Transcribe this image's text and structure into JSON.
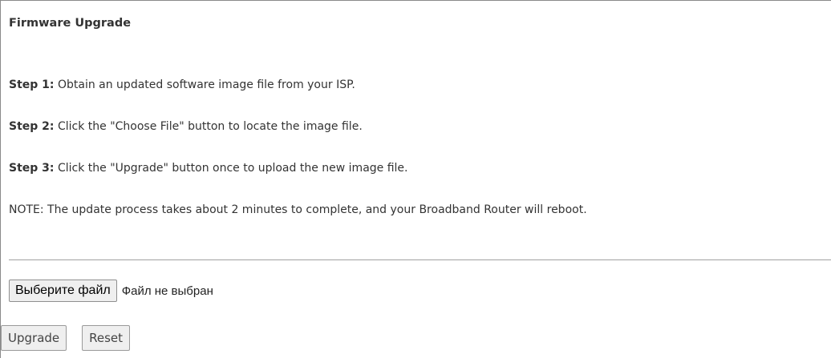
{
  "page": {
    "title": "Firmware Upgrade"
  },
  "steps": [
    {
      "label": "Step 1:",
      "text": " Obtain an updated software image file from your ISP."
    },
    {
      "label": "Step 2:",
      "text": " Click the \"Choose File\" button to locate the image file."
    },
    {
      "label": "Step 3:",
      "text": " Click the \"Upgrade\" button once to upload the new image file."
    }
  ],
  "note": "NOTE: The update process takes about 2 minutes to complete, and your Broadband Router will reboot.",
  "file_input": {
    "button_label": "Выберите файл",
    "status": "Файл не выбран"
  },
  "actions": {
    "upgrade_label": "Upgrade",
    "reset_label": "Reset"
  }
}
